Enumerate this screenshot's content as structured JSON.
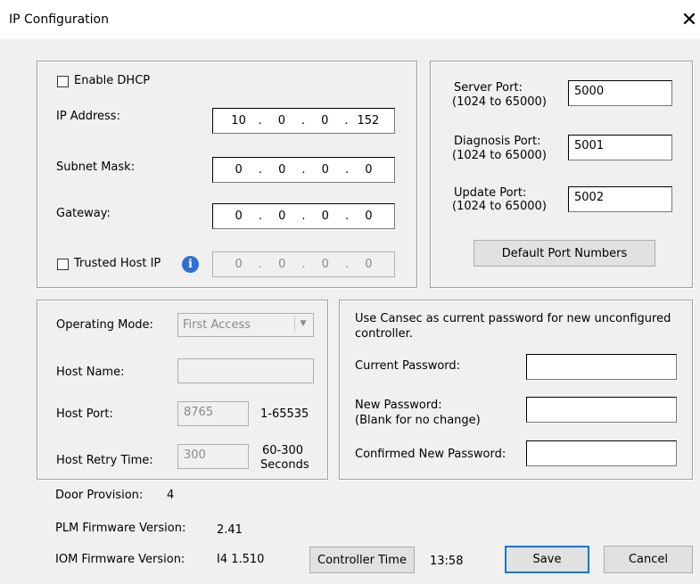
{
  "window": {
    "title": "IP Configuration",
    "close_glyph": "✕"
  },
  "network": {
    "enable_dhcp_label": "Enable DHCP",
    "enable_dhcp_checked": false,
    "ip_label": "IP Address:",
    "ip": [
      "10",
      "0",
      "0",
      "152"
    ],
    "subnet_label": "Subnet Mask:",
    "subnet": [
      "0",
      "0",
      "0",
      "0"
    ],
    "gateway_label": "Gateway:",
    "gateway": [
      "0",
      "0",
      "0",
      "0"
    ],
    "trusted_label": "Trusted Host IP",
    "trusted_checked": false,
    "trusted": [
      "0",
      "0",
      "0",
      "0"
    ],
    "ip_separator": "."
  },
  "ports": {
    "server_label": "Server Port:",
    "server_range": "(1024 to 65000)",
    "server_value": "5000",
    "diagnosis_label": "Diagnosis Port:",
    "diagnosis_range": "(1024 to 65000)",
    "diagnosis_value": "5001",
    "update_label": "Update Port:",
    "update_range": "(1024 to 65000)",
    "update_value": "5002",
    "default_button": "Default Port Numbers"
  },
  "host": {
    "mode_label": "Operating Mode:",
    "mode_value": "First Access",
    "name_label": "Host Name:",
    "name_value": "",
    "port_label": "Host Port:",
    "port_value": "8765",
    "port_range": "1-65535",
    "retry_label": "Host Retry Time:",
    "retry_value": "300",
    "retry_range": "60-300",
    "retry_unit": "Seconds"
  },
  "password": {
    "note": "Use Cansec as current password for new unconfigured controller.",
    "current_label": "Current Password:",
    "new_label": "New Password:",
    "new_hint": "(Blank for no change)",
    "confirm_label": "Confirmed New Password:"
  },
  "info": {
    "door_label": "Door Provision:",
    "door_value": "4",
    "plm_label": "PLM Firmware Version:",
    "plm_value": "2.41",
    "iom_label": "IOM Firmware Version:",
    "iom_value": "I4 1.510",
    "time_button": "Controller Time",
    "time_value": "13:58"
  },
  "actions": {
    "save": "Save",
    "cancel": "Cancel"
  },
  "icons": {
    "info": "i",
    "combo_arrow": "▼"
  }
}
